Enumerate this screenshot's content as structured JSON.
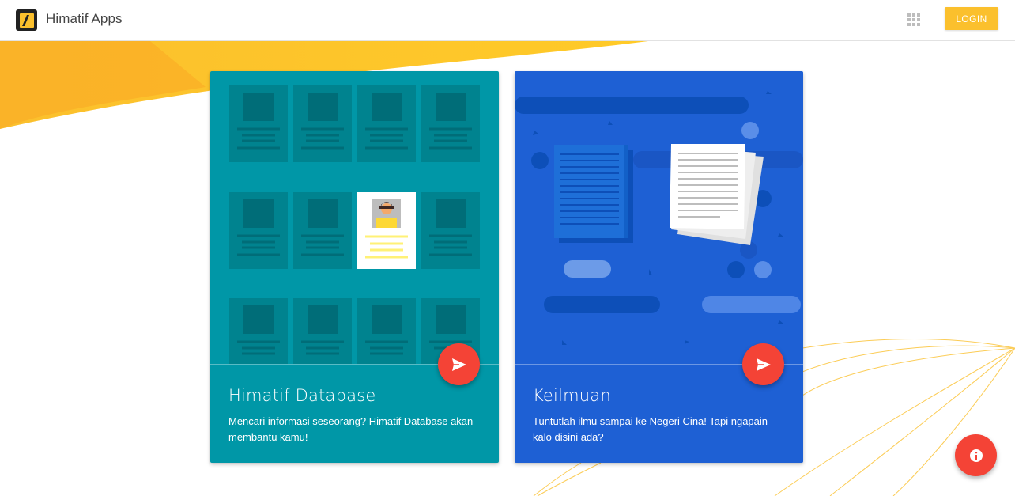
{
  "header": {
    "app_title": "Himatif Apps",
    "login_label": "LOGIN",
    "accent_color": "#fbc02d"
  },
  "cards": [
    {
      "title": "Himatif Database",
      "description": "Mencari informasi seseorang? Himatif Database akan membantu kamu!",
      "color": "#0097a7",
      "icon": "send-icon"
    },
    {
      "title": "Keilmuan",
      "description": "Tuntutlah ilmu sampai ke Negeri Cina! Tapi ngapain kalo disini ada?",
      "color": "#1e60d4",
      "icon": "send-icon"
    }
  ],
  "fab": {
    "icon": "info-icon",
    "color": "#f44336"
  },
  "icons": {
    "logo": "himatif-logo",
    "apps": "apps-grid-icon"
  }
}
